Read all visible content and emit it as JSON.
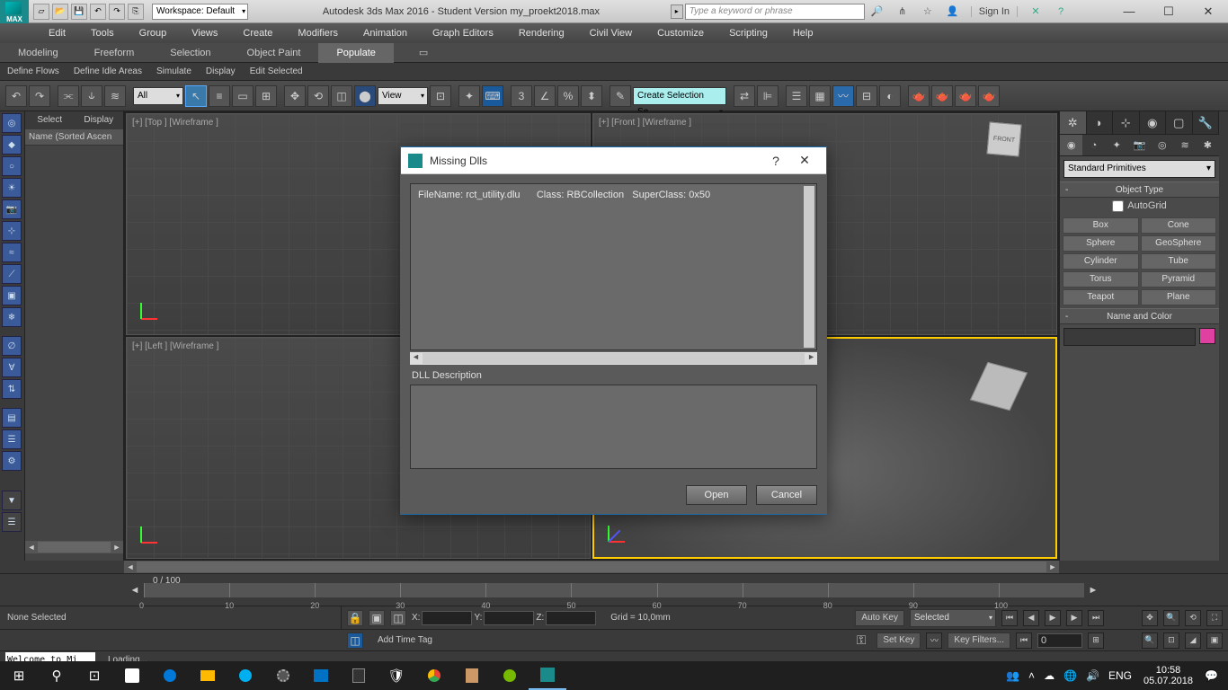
{
  "title": {
    "app_tag": "MAX",
    "workspace": "Workspace: Default",
    "text": "Autodesk 3ds Max 2016 - Student Version   my_proekt2018.max",
    "search_placeholder": "Type a keyword or phrase",
    "signin": "Sign In"
  },
  "menus": [
    "Edit",
    "Tools",
    "Group",
    "Views",
    "Create",
    "Modifiers",
    "Animation",
    "Graph Editors",
    "Rendering",
    "Civil View",
    "Customize",
    "Scripting",
    "Help"
  ],
  "ribbon_tabs": [
    "Modeling",
    "Freeform",
    "Selection",
    "Object Paint",
    "Populate"
  ],
  "ribbon_active": "Populate",
  "ribbon_sub": [
    "Define Flows",
    "Define Idle Areas",
    "Simulate",
    "Display",
    "Edit Selected"
  ],
  "toolbar": {
    "all_dd": "All",
    "view_dd": "View",
    "named_sel": "Create Selection Se"
  },
  "scene": {
    "tabs": [
      "Select",
      "Display"
    ],
    "header": "Name (Sorted Ascen"
  },
  "viewports": {
    "tl": "[+] [Top ] [Wireframe ]",
    "tr": "[+] [Front ] [Wireframe ]",
    "bl": "[+] [Left ] [Wireframe ]",
    "br": "",
    "viewcube_tr": "FRONT"
  },
  "cmd": {
    "cat_dd": "Standard Primitives",
    "rollout_objtype": "Object Type",
    "autogrid": "AutoGrid",
    "objects": [
      "Box",
      "Cone",
      "Sphere",
      "GeoSphere",
      "Cylinder",
      "Tube",
      "Torus",
      "Pyramid",
      "Teapot",
      "Plane"
    ],
    "rollout_name": "Name and Color"
  },
  "timeline": {
    "frame": "0 / 100",
    "ticks": [
      "0",
      "10",
      "20",
      "30",
      "40",
      "50",
      "60",
      "70",
      "80",
      "90",
      "100"
    ]
  },
  "status": {
    "selection": "None Selected",
    "x": "X:",
    "y": "Y:",
    "z": "Z:",
    "grid": "Grid = 10,0mm",
    "addtag": "Add Time Tag",
    "autokey": "Auto Key",
    "setkey": "Set Key",
    "sel_dd": "Selected",
    "keyfilters": "Key Filters...",
    "frame_val": "0"
  },
  "loading": {
    "welcome": "Welcome to Mi",
    "text": "Loading..."
  },
  "taskbar": {
    "lang": "ENG",
    "time": "10:58",
    "date": "05.07.2018"
  },
  "dialog": {
    "title": "Missing Dlls",
    "list_filename_k": "FileName:",
    "list_filename_v": "rct_utility.dlu",
    "list_class_k": "Class:",
    "list_class_v": "RBCollection",
    "list_super_k": "SuperClass:",
    "list_super_v": "0x50",
    "desc_label": "DLL Description",
    "open": "Open",
    "cancel": "Cancel"
  }
}
